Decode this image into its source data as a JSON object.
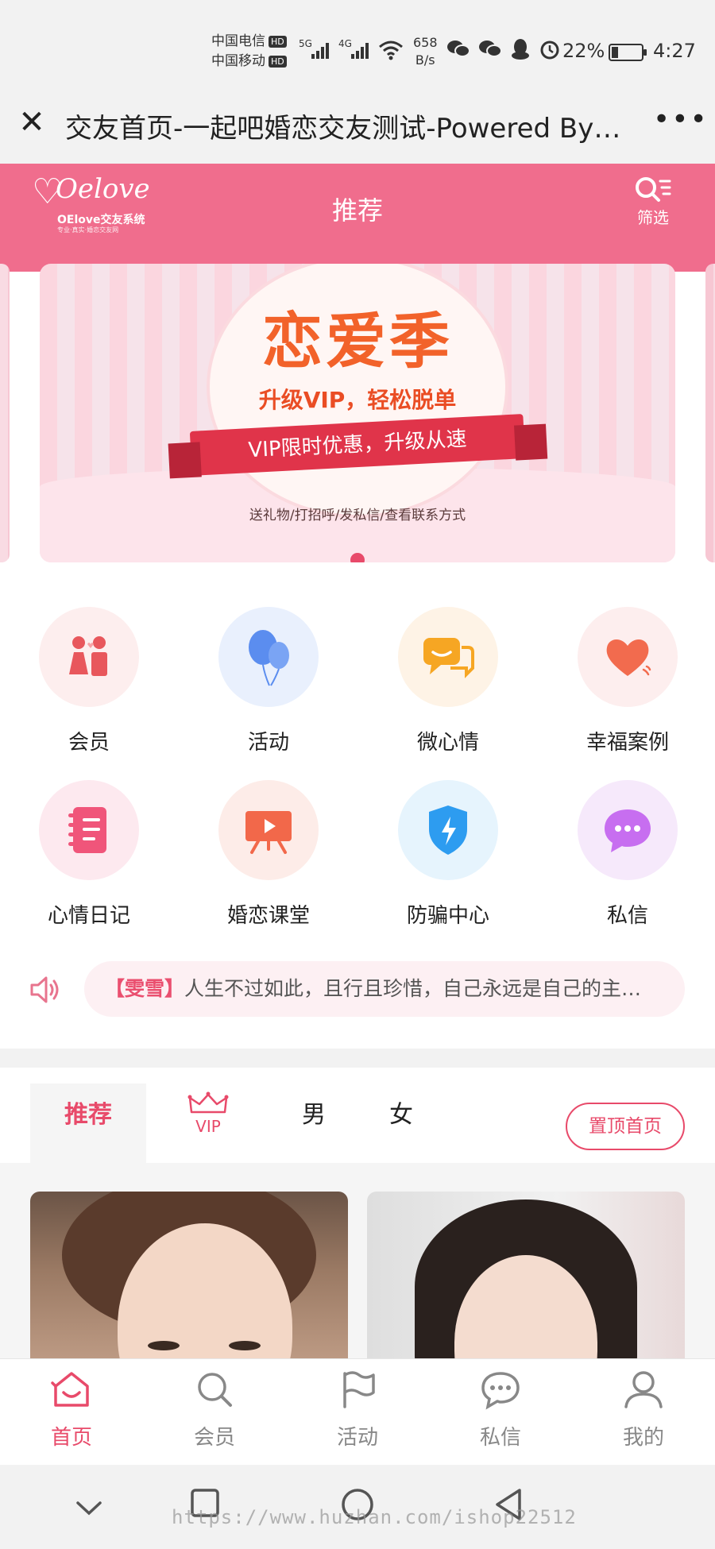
{
  "status_bar": {
    "carrier1": "中国电信",
    "carrier2": "中国移动",
    "hd": "HD",
    "sig1": "5G",
    "sig2": "4G",
    "speed_value": "658",
    "speed_unit": "B/s",
    "battery": "22%",
    "battery_level": 0.22,
    "time": "4:27"
  },
  "browser": {
    "title": "交友首页-一起吧婚恋交友测试-Powered By…",
    "close_icon": "close-icon",
    "more_icon": "more-icon"
  },
  "header": {
    "logo_script": "Oelove",
    "logo_brand": "OElove交友系统",
    "logo_tagline": "专业·真实·婚恋交友网",
    "title": "推荐",
    "filter_label": "筛选",
    "accent": "#f06d8d"
  },
  "banner": {
    "title": "恋爱季",
    "subtitle": "升级VIP，轻松脱单",
    "ribbon": "VIP限时优惠，升级从速",
    "features": "送礼物/打招呼/发私信/查看联系方式",
    "active_dot": 1,
    "dot_count": 1
  },
  "menu": {
    "items": [
      {
        "label": "会员",
        "icon": "couple-icon",
        "bg": "#fdeeee"
      },
      {
        "label": "活动",
        "icon": "balloon-icon",
        "bg": "#e9f0fd"
      },
      {
        "label": "微心情",
        "icon": "chat-bubble-icon",
        "bg": "#fef3e6"
      },
      {
        "label": "幸福案例",
        "icon": "heart-icon",
        "bg": "#fdeeee"
      },
      {
        "label": "心情日记",
        "icon": "diary-icon",
        "bg": "#fde9ef"
      },
      {
        "label": "婚恋课堂",
        "icon": "classroom-icon",
        "bg": "#fdece8"
      },
      {
        "label": "防骗中心",
        "icon": "shield-icon",
        "bg": "#e6f4fd"
      },
      {
        "label": "私信",
        "icon": "message-icon",
        "bg": "#f6e9fb"
      }
    ]
  },
  "notice": {
    "user": "【雯雪】",
    "text": "人生不过如此，且行且珍惜，自己永远是自己的主…"
  },
  "tabs": {
    "recommend": "推荐",
    "vip": "VIP",
    "male": "男",
    "female": "女",
    "pin_button": "置顶首页"
  },
  "bottom_nav": {
    "items": [
      {
        "label": "首页",
        "icon": "home-icon",
        "active": true
      },
      {
        "label": "会员",
        "icon": "search-icon",
        "active": false
      },
      {
        "label": "活动",
        "icon": "flag-icon",
        "active": false
      },
      {
        "label": "私信",
        "icon": "chat-icon",
        "active": false
      },
      {
        "label": "我的",
        "icon": "user-icon",
        "active": false
      }
    ],
    "active_color": "#e84a6a"
  },
  "watermark": "https://www.huzhan.com/ishop22512"
}
